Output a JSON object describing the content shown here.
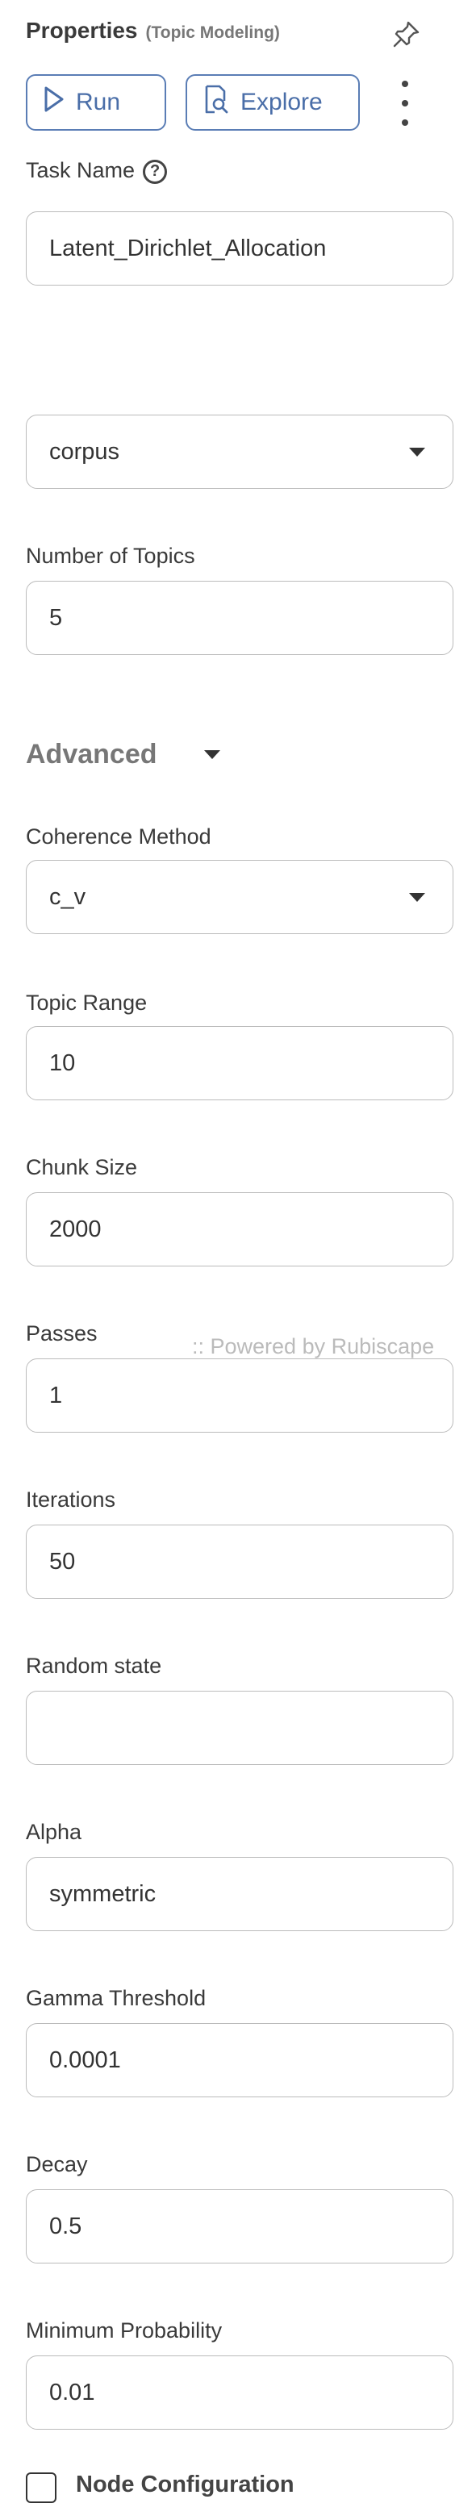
{
  "header": {
    "title": "Properties",
    "subtitle": "(Topic Modeling)",
    "pin_icon": "pin-icon"
  },
  "toolbar": {
    "run_label": "Run",
    "explore_label": "Explore",
    "more_icon": "more-vertical-icon",
    "accent": "#4a6ea8"
  },
  "task": {
    "label": "Task Name",
    "value": "Latent_Dirichlet_Allocation"
  },
  "corpus": {
    "value": "corpus"
  },
  "topics": {
    "label": "Number of Topics",
    "value": "5"
  },
  "advanced": {
    "label": "Advanced"
  },
  "coherence": {
    "label": "Coherence Method",
    "value": "c_v"
  },
  "topic_range": {
    "label": "Topic Range",
    "value": "10"
  },
  "chunk_size": {
    "label": "Chunk Size",
    "value": "2000"
  },
  "passes": {
    "label": "Passes",
    "value": "1"
  },
  "watermark": ":: Powered by Rubiscape",
  "iterations": {
    "label": "Iterations",
    "value": "50"
  },
  "random_state": {
    "label": "Random state",
    "value": ""
  },
  "alpha": {
    "label": "Alpha",
    "value": "symmetric"
  },
  "gamma": {
    "label": "Gamma Threshold",
    "value": "0.0001"
  },
  "decay": {
    "label": "Decay",
    "value": "0.5"
  },
  "min_prob": {
    "label": "Minimum Probability",
    "value": "0.01"
  },
  "node_config": {
    "label": "Node Configuration",
    "checked": false
  }
}
